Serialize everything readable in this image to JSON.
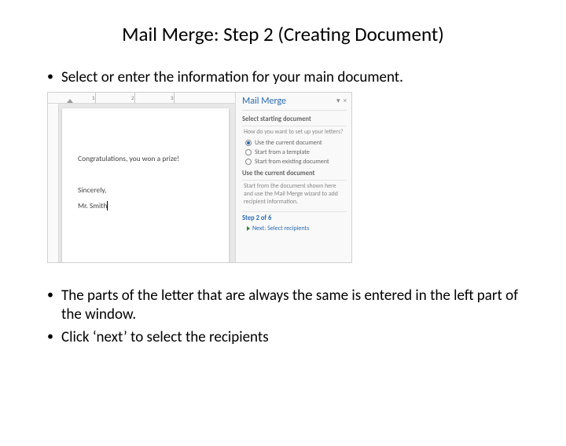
{
  "title": "Mail Merge: Step 2 (Creating Document)",
  "bullets": {
    "b1": "Select or enter the information for your main document.",
    "b2": "The parts of the letter that are always the same is entered in the left part of the window.",
    "b3": "Click ‘next’ to select the recipients"
  },
  "screenshot": {
    "ruler": {
      "mark1": "1",
      "mark2": "2",
      "mark3": "3"
    },
    "doc": {
      "line1": "Congratulations, you won a prize!",
      "line2": "Sincerely,",
      "line3": "Mr. Smith"
    },
    "pane": {
      "title": "Mail Merge",
      "dropdown_glyph": "▾",
      "close_glyph": "×",
      "section1": "Select starting document",
      "q1": "How do you want to set up your letters?",
      "opt1": "Use the current document",
      "opt2": "Start from a template",
      "opt3": "Start from existing document",
      "section2": "Use the current document",
      "desc2": "Start from the document shown here and use the Mail Merge wizard to add recipient information.",
      "step": "Step 2 of 6",
      "next": "Next: Select recipients"
    }
  }
}
